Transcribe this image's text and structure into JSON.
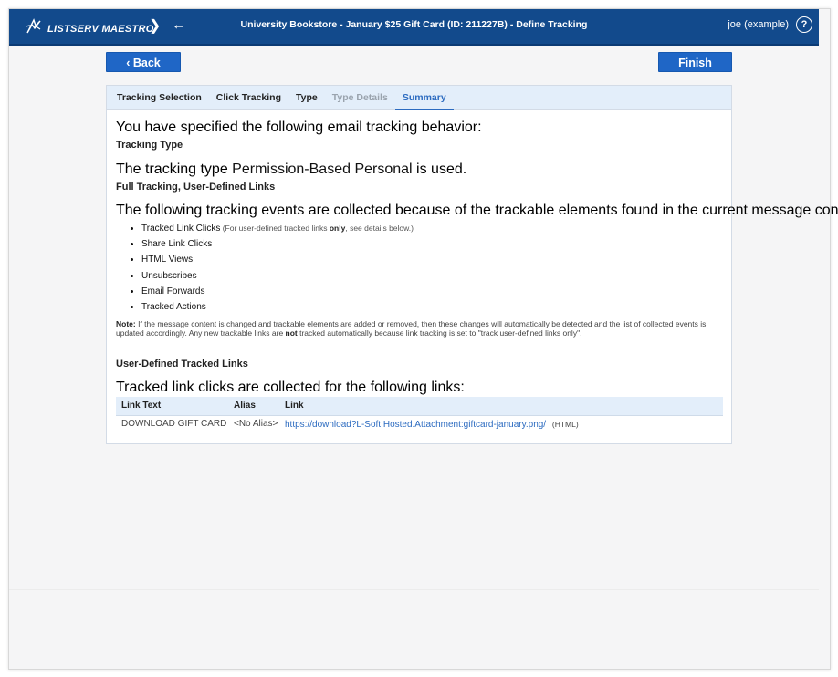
{
  "app": {
    "logo_text": "LISTSERV MAESTRO",
    "page_title": "University Bookstore - January $25 Gift Card (ID: 211227B) - Define Tracking",
    "user": "joe (example)"
  },
  "colors": {
    "topbar": "#124a8c",
    "button": "#1f66c6",
    "tab_active": "#2c6bc0",
    "tab_bar": "#e3eefa"
  },
  "icons": {
    "logo": "listserv-maestro-logo-icon",
    "next": "chevron-right-icon",
    "back": "arrow-left-icon",
    "help": "help-circle-icon"
  },
  "buttons": {
    "back": "‹ Back",
    "finish": "Finish"
  },
  "tabs": [
    {
      "label": "Tracking Selection",
      "state": "normal"
    },
    {
      "label": "Click Tracking",
      "state": "normal"
    },
    {
      "label": "Type",
      "state": "normal"
    },
    {
      "label": "Type Details",
      "state": "disabled"
    },
    {
      "label": "Summary",
      "state": "active"
    }
  ],
  "summary": {
    "intro": "You have specified the following email tracking behavior:",
    "tracking_type_heading": "Tracking Type",
    "tracking_type_pre": "The tracking type ",
    "tracking_type_value": "Permission-Based Personal",
    "tracking_type_post": " is used.",
    "full_tracking_heading": "Full Tracking, User-Defined Links",
    "events_intro": "The following tracking events are collected because of the trackable elements found in the current message content:",
    "events": [
      {
        "label": "Tracked Link Clicks",
        "note_pre": " (For user-defined tracked links ",
        "note_strong": "only",
        "note_post": ", see details below.)"
      },
      {
        "label": "Share Link Clicks"
      },
      {
        "label": "HTML Views"
      },
      {
        "label": "Unsubscribes"
      },
      {
        "label": "Email Forwards"
      },
      {
        "label": "Tracked Actions"
      }
    ],
    "note_label": "Note:",
    "note_text_1": " If the message content is changed and trackable elements are added or removed, then these changes will automatically be detected and the list of collected events is updated accordingly. Any new trackable links are ",
    "note_strong": "not",
    "note_text_2": " tracked automatically because link tracking is set to \"track user-defined links only\".",
    "links_heading": "User-Defined Tracked Links",
    "links_intro": "Tracked link clicks are collected for the following links:"
  },
  "links_table": {
    "headers": [
      "Link Text",
      "Alias",
      "Link"
    ],
    "rows": [
      {
        "text": "DOWNLOAD GIFT CARD",
        "alias": "<No Alias>",
        "url": "https://download?L-Soft.Hosted.Attachment:giftcard-january.png/",
        "format": "(HTML)"
      }
    ]
  }
}
